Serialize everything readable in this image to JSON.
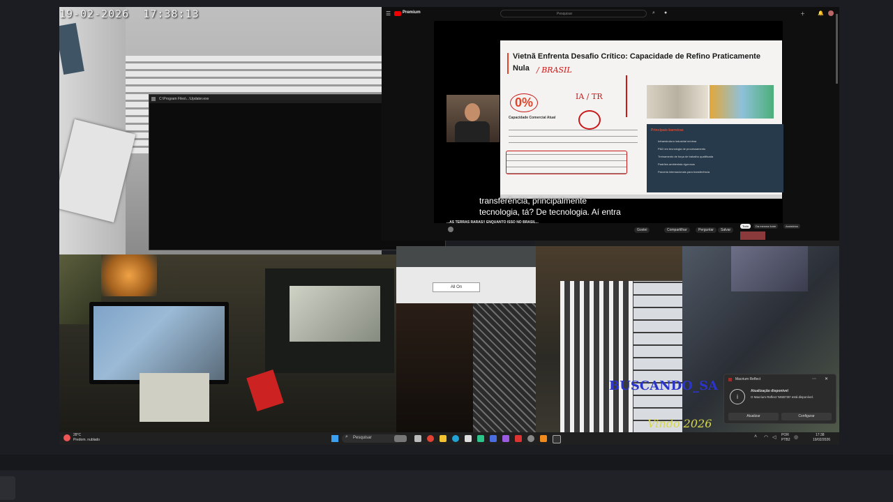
{
  "camera_top_left": {
    "timestamp": "19-02-2026  17:38:13"
  },
  "cmd_window": {
    "title": "C:\\Program Files\\...\\Updater.exe",
    "minimize": "–",
    "maximize": "▢",
    "close": "✕"
  },
  "youtube": {
    "logo": "Premium",
    "search_placeholder": "Pesquisar",
    "slide": {
      "title_line1": "Vietnã Enfrenta Desafio Crítico: Capacidade de Refino Praticamente",
      "title_line2": "Nula",
      "handwritten_note": "/ BRASIL",
      "stat": "0%",
      "stat_label": "Capacidade Comercial Atual",
      "handwritten_ia": "IA / TR",
      "right_heading": "Principais barreiras",
      "barriers": [
        "Infraestrutura industrial mínima",
        "P&D em tecnologia de processamento",
        "Treinamento de força de trabalho qualificada",
        "Padrões ambientais rigorosos",
        "Parceria internacionais para transferência"
      ]
    },
    "caption_line1": "transferência, principalmente",
    "caption_line2": "tecnologia, tá? De tecnologia. Aí entra",
    "video_title": "...AS TERRAS RARAS!! ENQUANTO ISSO NO BRASIL...",
    "actions": [
      "Gostei",
      "Compartilhar",
      "Perguntar",
      "Salvar"
    ],
    "chips": [
      "Tudo",
      "Da mesma fonte",
      "Assistidos"
    ]
  },
  "monitor_bottom_center": {
    "button": "All On"
  },
  "overlay_text": {
    "blue": "BUSCANDO_SA",
    "yellow": "Vindo 2026"
  },
  "taskbar": {
    "weather_temp": "28°C",
    "weather_desc": "Predom. nublado",
    "search_placeholder": "Pesquisar",
    "language": "POR",
    "layout": "PTB2",
    "time": "17:38",
    "date": "19/02/2026"
  },
  "toast": {
    "app": "Macrium Reflect",
    "title": "Atualização disponível",
    "message": "O Macrium Reflect 'MSB730' está disponível.",
    "primary": "Atualizar",
    "secondary": "Configurar"
  },
  "colors": {
    "accent": "#e0452b",
    "toast_bg": "#2b2b2b",
    "page_bg": "#1b1d22"
  }
}
